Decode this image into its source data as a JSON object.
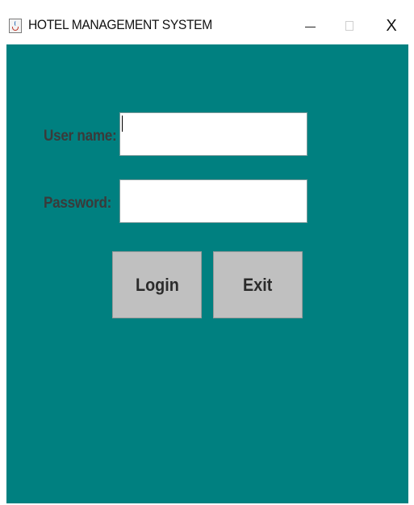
{
  "window": {
    "title": "HOTEL MANAGEMENT SYSTEM",
    "app_icon": "java-cup-icon",
    "controls": {
      "minimize": "minimize-icon",
      "maximize": "maximize-icon",
      "close_label": "X"
    }
  },
  "form": {
    "username_label": "User name:",
    "username_value": "",
    "password_label": "Password:",
    "password_value": ""
  },
  "buttons": {
    "login_label": "Login",
    "exit_label": "Exit"
  },
  "colors": {
    "background": "#008080",
    "button": "#c0c0c0",
    "label_text": "#3a3a3a"
  }
}
